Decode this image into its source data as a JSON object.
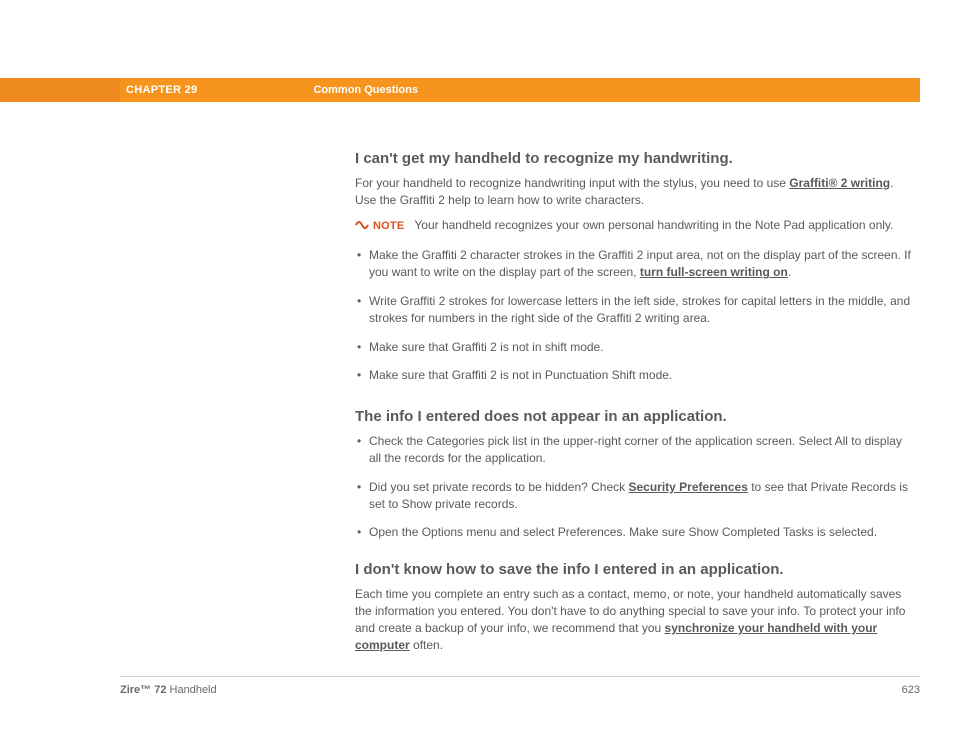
{
  "header": {
    "chapter": "CHAPTER 29",
    "section": "Common Questions"
  },
  "sections": {
    "handwriting": {
      "title": "I can't get my handheld to recognize my handwriting.",
      "intro_pre": "For your handheld to recognize handwriting input with the stylus, you need to use ",
      "link1": "Graffiti® 2 writing",
      "intro_post": ". Use the Graffiti 2 help to learn how to write characters.",
      "note_label": "NOTE",
      "note_text": "Your handheld recognizes your own personal handwriting in the Note Pad application only.",
      "b1_pre": "Make the Graffiti 2 character strokes in the Graffiti 2 input area, not on the display part of the screen. If you want to write on the display part of the screen, ",
      "b1_link": "turn full-screen writing on",
      "b1_post": ".",
      "b2": "Write Graffiti 2 strokes for lowercase letters in the left side, strokes for capital letters in the middle, and strokes for numbers in the right side of the Graffiti 2 writing area.",
      "b3": "Make sure that Graffiti 2 is not in shift mode.",
      "b4": "Make sure that Graffiti 2 is not in Punctuation Shift mode."
    },
    "info_missing": {
      "title": "The info I entered does not appear in an application.",
      "b1": "Check the Categories pick list in the upper-right corner of the application screen. Select All to display all the records for the application.",
      "b2_pre": "Did you set private records to be hidden? Check ",
      "b2_link": "Security Preferences",
      "b2_post": " to see that Private Records is set to Show private records.",
      "b3": "Open the Options menu and select Preferences. Make sure Show Completed Tasks is selected."
    },
    "save_info": {
      "title": "I don't know how to save the info I entered in an application.",
      "p_pre": "Each time you complete an entry such as a contact, memo, or note, your handheld automatically saves the information you entered. You don't have to do anything special to save your info. To protect your info and create a backup of your info, we recommend that you ",
      "p_link": "synchronize your handheld with your computer",
      "p_post": " often."
    }
  },
  "footer": {
    "product_bold": "Zire™ 72",
    "product_rest": " Handheld",
    "page": "623"
  }
}
